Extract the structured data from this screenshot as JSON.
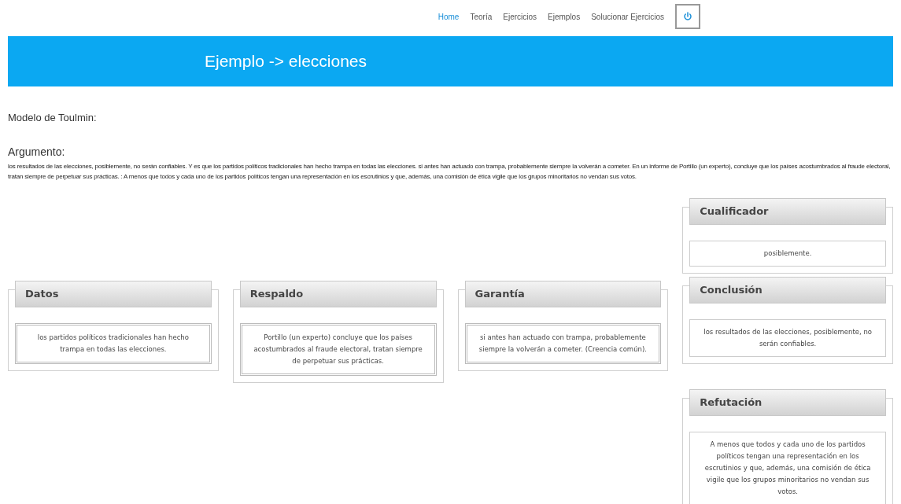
{
  "nav": {
    "items": [
      {
        "label": "Home",
        "selected": true
      },
      {
        "label": "Teoría",
        "selected": false
      },
      {
        "label": "Ejercicios",
        "selected": false
      },
      {
        "label": "Ejemplos",
        "selected": false
      },
      {
        "label": "Solucionar Ejercicios",
        "selected": false
      }
    ]
  },
  "banner": {
    "title": "Ejemplo -> elecciones"
  },
  "model_heading": "Modelo de Toulmin:",
  "argument": {
    "heading": "Argumento:",
    "text": "los resultados de las elecciones, posiblemente, no serán confiables. Y es que los partidos políticos tradicionales han hecho trampa en todas las elecciones. si antes han actuado con trampa, probablemente siempre la volverán a cometer. En un informe de Portillo (un experto), concluye que los países acostumbrados al fraude electoral, tratan siempre de perpetuar sus prácticas. : A menos que todos y cada uno de los partidos políticos tengan una representación en los escrutinios y que, además, una comisión de ética vigile que los grupos minoritarios no vendan sus votos."
  },
  "diagram": {
    "left": [
      {
        "title": "Datos",
        "text": "los partidos políticos tradicionales han hecho trampa en todas las elecciones.",
        "kind": "double"
      },
      {
        "title": "Respaldo",
        "text": "Portillo (un experto) concluye que los países acostumbrados al fraude electoral, tratan siempre de perpetuar sus prácticas.",
        "kind": "double"
      },
      {
        "title": "Garantía",
        "text": "si antes han actuado con trampa, probablemente siempre la volverán a cometer. (Creencia común).",
        "kind": "double"
      }
    ],
    "right": [
      {
        "title": "Cualificador",
        "text": "posiblemente.",
        "kind": "single"
      },
      {
        "title": "Conclusión",
        "text": "los resultados de las elecciones, posiblemente, no serán confiables.",
        "kind": "single"
      },
      {
        "title": "Refutación",
        "text": "A menos que todos y cada uno de los partidos políticos tengan una representación en los escrutinios y que, además, una comisión de ética vigile que los grupos minoritarios no vendan sus votos.",
        "kind": "single"
      }
    ]
  }
}
